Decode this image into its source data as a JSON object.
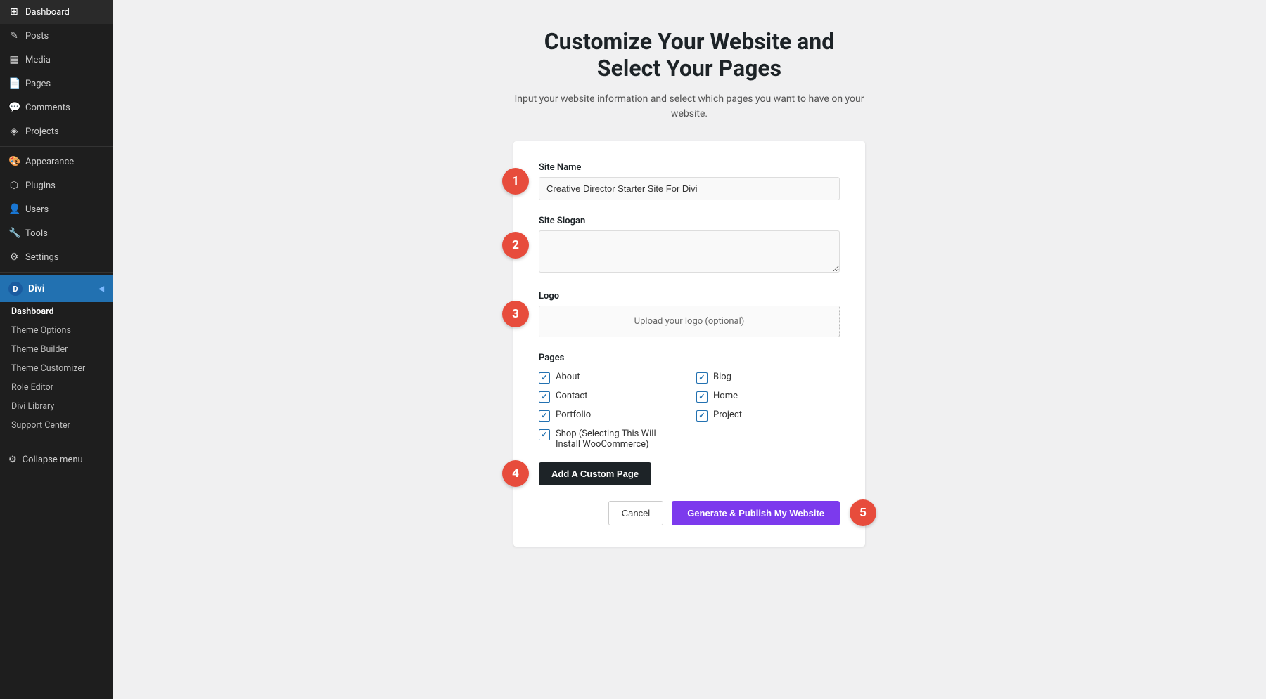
{
  "sidebar": {
    "items": [
      {
        "id": "dashboard",
        "label": "Dashboard",
        "icon": "⊞"
      },
      {
        "id": "posts",
        "label": "Posts",
        "icon": "✏"
      },
      {
        "id": "media",
        "label": "Media",
        "icon": "🖼"
      },
      {
        "id": "pages",
        "label": "Pages",
        "icon": "📄"
      },
      {
        "id": "comments",
        "label": "Comments",
        "icon": "💬"
      },
      {
        "id": "projects",
        "label": "Projects",
        "icon": "📌"
      },
      {
        "id": "appearance",
        "label": "Appearance",
        "icon": "🎨"
      },
      {
        "id": "plugins",
        "label": "Plugins",
        "icon": "🔌"
      },
      {
        "id": "users",
        "label": "Users",
        "icon": "👤"
      },
      {
        "id": "tools",
        "label": "Tools",
        "icon": "🔧"
      },
      {
        "id": "settings",
        "label": "Settings",
        "icon": "⚙"
      }
    ],
    "divi": {
      "label": "Divi",
      "icon": "D",
      "submenu": [
        {
          "id": "dashboard",
          "label": "Dashboard"
        },
        {
          "id": "theme-options",
          "label": "Theme Options"
        },
        {
          "id": "theme-builder",
          "label": "Theme Builder"
        },
        {
          "id": "theme-customizer",
          "label": "Theme Customizer"
        },
        {
          "id": "role-editor",
          "label": "Role Editor"
        },
        {
          "id": "divi-library",
          "label": "Divi Library"
        },
        {
          "id": "support-center",
          "label": "Support Center"
        }
      ]
    },
    "collapse_label": "Collapse menu"
  },
  "main": {
    "title_line1": "Customize Your Website and",
    "title_line2": "Select Your Pages",
    "subtitle": "Input your website information and select which pages you want to have on your website.",
    "steps": {
      "step1": {
        "badge": "1",
        "field_label": "Site Name",
        "field_value": "Creative Director Starter Site For Divi",
        "field_placeholder": "Creative Director Starter Site For Divi"
      },
      "step2": {
        "badge": "2",
        "field_label": "Site Slogan",
        "field_value": "",
        "field_placeholder": ""
      },
      "step3": {
        "badge": "3",
        "field_label": "Logo",
        "upload_label": "Upload your logo (optional)"
      },
      "pages": {
        "label": "Pages",
        "items_col1": [
          {
            "id": "about",
            "label": "About",
            "checked": true
          },
          {
            "id": "contact",
            "label": "Contact",
            "checked": true
          },
          {
            "id": "portfolio",
            "label": "Portfolio",
            "checked": true
          },
          {
            "id": "shop",
            "label": "Shop (Selecting This Will Install WooCommerce)",
            "checked": true
          }
        ],
        "items_col2": [
          {
            "id": "blog",
            "label": "Blog",
            "checked": true
          },
          {
            "id": "home",
            "label": "Home",
            "checked": true
          },
          {
            "id": "project",
            "label": "Project",
            "checked": true
          }
        ]
      },
      "step4": {
        "badge": "4",
        "button_label": "Add A Custom Page"
      },
      "step5": {
        "badge": "5",
        "cancel_label": "Cancel",
        "publish_label": "Generate & Publish My Website"
      }
    }
  }
}
